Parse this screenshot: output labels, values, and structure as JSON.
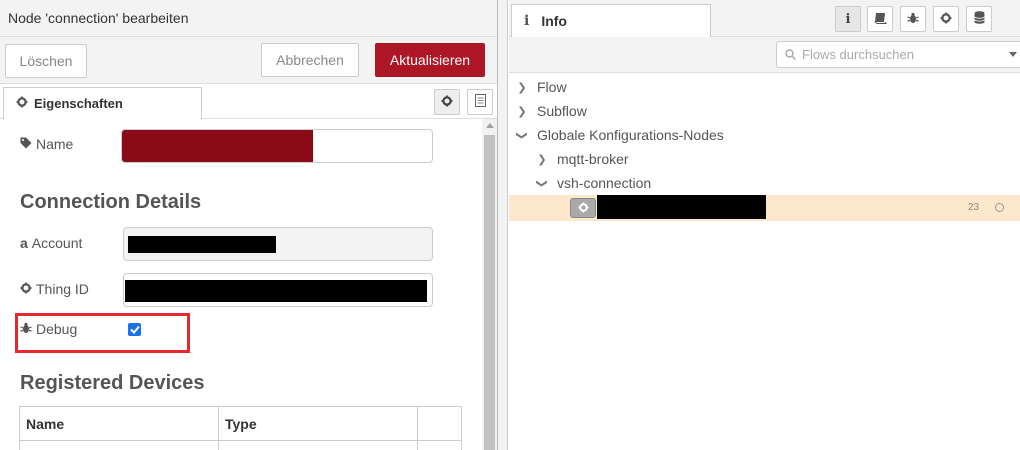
{
  "tray": {
    "title": "Node 'connection' bearbeiten",
    "delete_label": "Löschen",
    "cancel_label": "Abbrechen",
    "update_label": "Aktualisieren",
    "tab_properties": "Eigenschaften"
  },
  "form": {
    "name_label": "Name",
    "connection_heading": "Connection Details",
    "account_label": "Account",
    "thing_label": "Thing ID",
    "debug_label": "Debug",
    "debug_checked": true,
    "devices_heading": "Registered Devices",
    "table_headers": [
      "Name",
      "Type"
    ]
  },
  "sidebar": {
    "info_tab": "Info",
    "search_placeholder": "Flows durchsuchen",
    "tree": {
      "flow": "Flow",
      "subflow": "Subflow",
      "global_config": "Globale Konfigurations-Nodes",
      "mqtt_broker": "mqtt-broker",
      "vsh_connection": "vsh-connection",
      "node_count": "23"
    }
  },
  "colors": {
    "accent": "#ad1625",
    "selected_row": "#fde8cb",
    "highlight_box": "#e8262e"
  }
}
